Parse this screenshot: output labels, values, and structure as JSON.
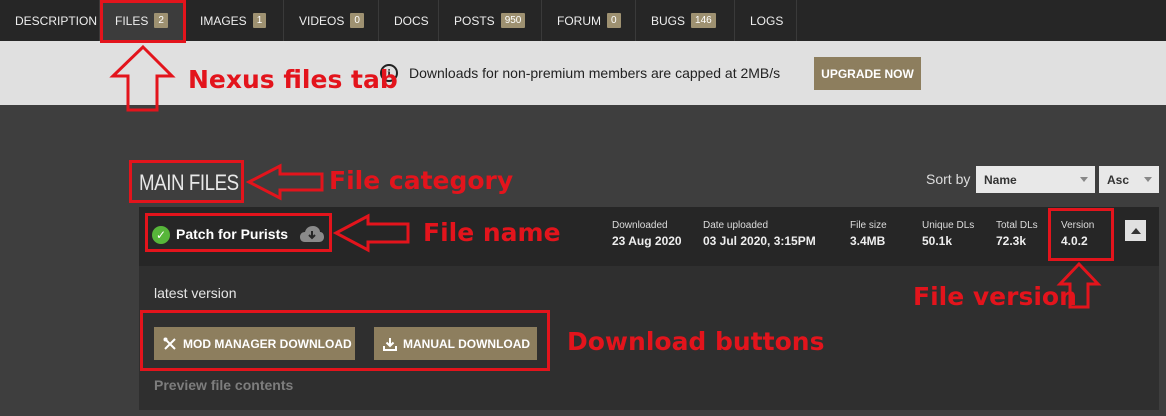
{
  "tabs": [
    {
      "label": "DESCRIPTION",
      "badge": null
    },
    {
      "label": "FILES",
      "badge": "2"
    },
    {
      "label": "IMAGES",
      "badge": "1"
    },
    {
      "label": "VIDEOS",
      "badge": "0"
    },
    {
      "label": "DOCS",
      "badge": null
    },
    {
      "label": "POSTS",
      "badge": "950"
    },
    {
      "label": "FORUM",
      "badge": "0"
    },
    {
      "label": "BUGS",
      "badge": "146"
    },
    {
      "label": "LOGS",
      "badge": null
    }
  ],
  "banner": {
    "icon": "info-icon",
    "text": "Downloads for non-premium members are capped at 2MB/s",
    "upgrade_label": "UPGRADE NOW"
  },
  "section": {
    "title": "MAIN FILES",
    "sort_label": "Sort by",
    "sort_field": "Name",
    "sort_dir": "Asc"
  },
  "file": {
    "name": "Patch for Purists",
    "status_icon": "check-icon",
    "stats": [
      {
        "label": "Downloaded",
        "value": "23 Aug 2020"
      },
      {
        "label": "Date uploaded",
        "value": "03 Jul 2020, 3:15PM"
      },
      {
        "label": "File size",
        "value": "3.4MB"
      },
      {
        "label": "Unique DLs",
        "value": "50.1k"
      },
      {
        "label": "Total DLs",
        "value": "72.3k"
      },
      {
        "label": "Version",
        "value": "4.0.2"
      }
    ],
    "description": "latest version",
    "mod_manager_label": "MOD MANAGER DOWNLOAD",
    "manual_label": "MANUAL DOWNLOAD",
    "preview_label": "Preview file contents"
  },
  "annotations": {
    "files_tab": "Nexus files tab",
    "category": "File category",
    "file_name": "File name",
    "version": "File version",
    "buttons": "Download buttons"
  },
  "colors": {
    "annotation": "#e3141c",
    "accent": "#8d7e5e",
    "badge": "#9e9171",
    "check": "#57b63a"
  }
}
